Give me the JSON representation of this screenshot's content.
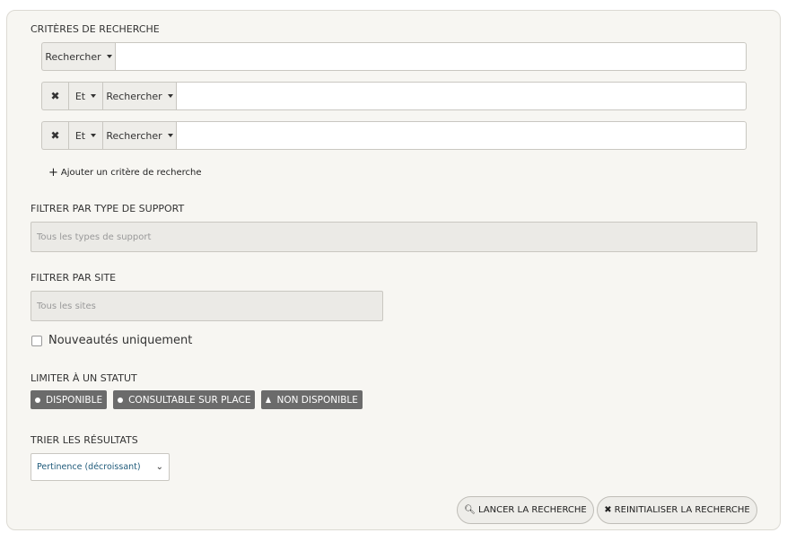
{
  "criteria": {
    "title": "CRITÈRES DE RECHERCHE",
    "rows": [
      {
        "field_label": "Rechercher",
        "value": ""
      },
      {
        "remove_icon": "✖",
        "operator": "Et",
        "field_label": "Rechercher",
        "value": ""
      },
      {
        "remove_icon": "✖",
        "operator": "Et",
        "field_label": "Rechercher",
        "value": ""
      }
    ],
    "add_label": "Ajouter un critère de recherche"
  },
  "support_filter": {
    "title": "FILTRER PAR TYPE DE SUPPORT",
    "placeholder": "Tous les types de support"
  },
  "site_filter": {
    "title": "FILTRER PAR SITE",
    "placeholder": "Tous les sites"
  },
  "new_only": {
    "label": "Nouveautés uniquement",
    "checked": false
  },
  "status": {
    "title": "LIMITER À UN STATUT",
    "badges": [
      {
        "label": "DISPONIBLE",
        "icon": "dot"
      },
      {
        "label": "CONSULTABLE SUR PLACE",
        "icon": "dot"
      },
      {
        "label": "NON DISPONIBLE",
        "icon": "triangle"
      }
    ]
  },
  "sort": {
    "title": "TRIER LES RÉSULTATS",
    "selected": "Pertinence (décroissant)"
  },
  "actions": {
    "search_label": "LANCER LA RECHERCHE",
    "reset_label": "REINITIALISER LA RECHERCHE"
  },
  "colors": {
    "panel_bg": "#f7f6f2",
    "badge_bg": "#6b6b6b",
    "sort_text": "#1f5a7a"
  }
}
